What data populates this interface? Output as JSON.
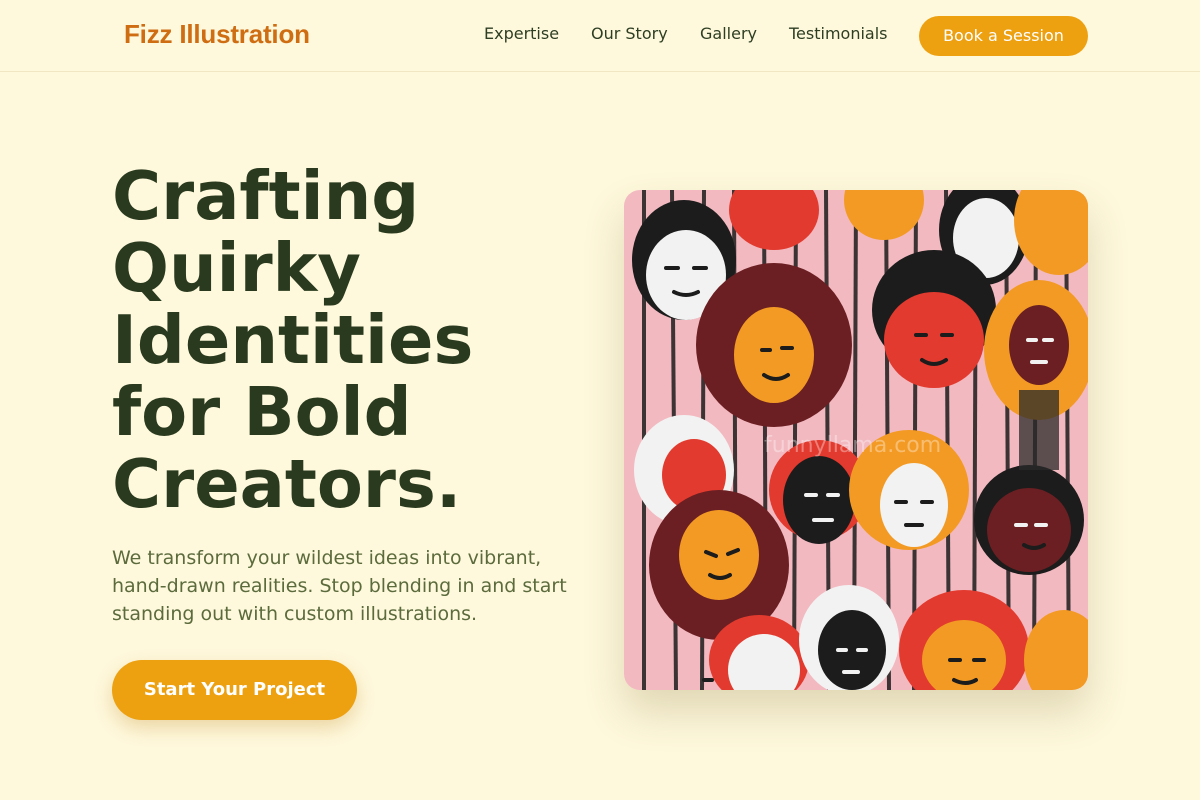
{
  "brand": {
    "name": "Fizz Illustration",
    "color": "#cf6d12"
  },
  "nav": {
    "links": [
      "Expertise",
      "Our Story",
      "Gallery",
      "Testimonials"
    ],
    "cta_label": "Book a Session"
  },
  "hero": {
    "headline_lines": [
      "Crafting",
      "Quirky",
      "Identities",
      "for Bold",
      "Creators."
    ],
    "subtext": "We transform your wildest ideas into vibrant, hand-drawn realities. Stop blending in and start standing out with custom illustrations.",
    "cta_label": "Start Your Project",
    "image": {
      "watermark": "funnyllama.com",
      "subject": "painted mural of colorful cartoon faces"
    }
  },
  "colors": {
    "background": "#fef8dc",
    "accent": "#eda010",
    "heading": "#2a3a1e",
    "body": "#5b6b3c"
  }
}
